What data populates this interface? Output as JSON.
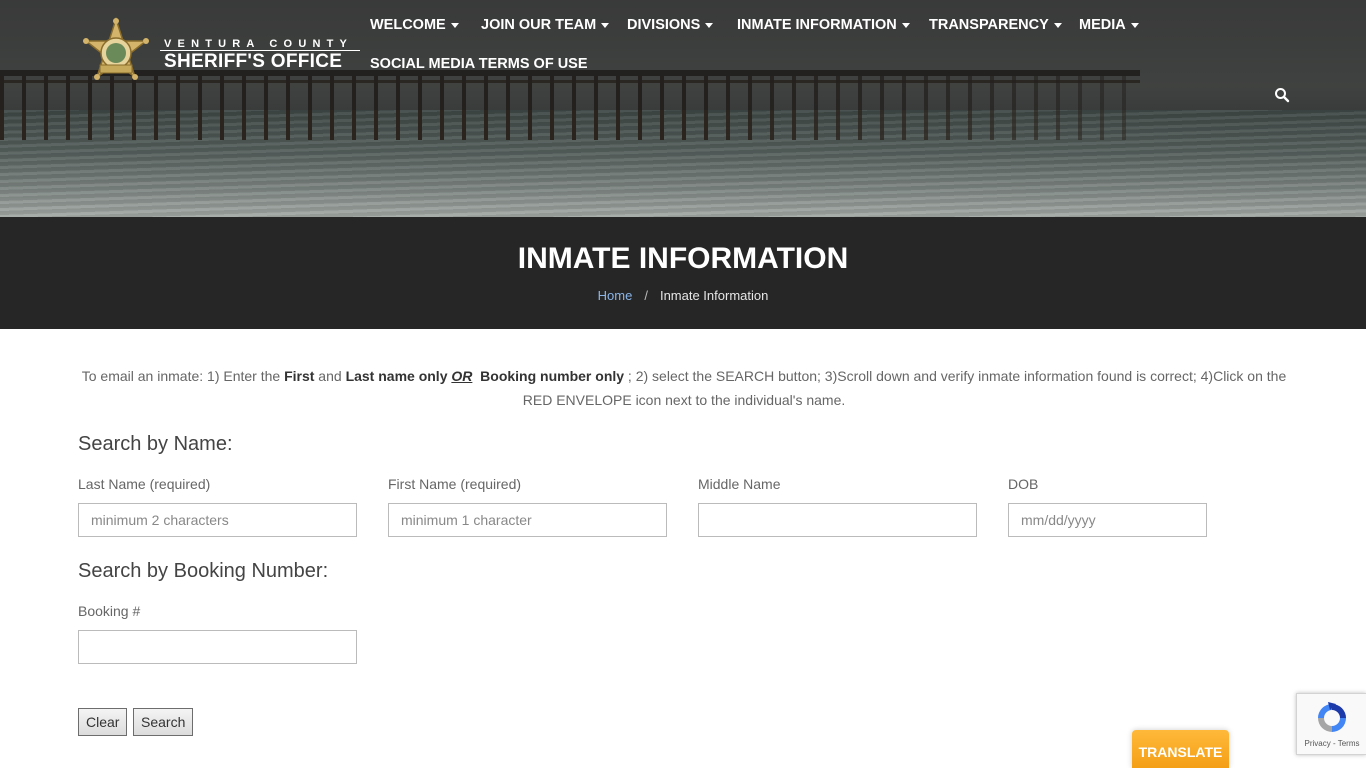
{
  "header": {
    "logo": {
      "county": "VENTURA COUNTY",
      "office": "SHERIFF'S OFFICE",
      "badge_icon": "sheriff-star-badge-icon"
    },
    "nav": [
      {
        "label": "WELCOME",
        "dropdown": true
      },
      {
        "label": "JOIN OUR TEAM",
        "dropdown": true
      },
      {
        "label": "DIVISIONS",
        "dropdown": true
      },
      {
        "label": "INMATE INFORMATION",
        "dropdown": true
      },
      {
        "label": "TRANSPARENCY",
        "dropdown": true
      },
      {
        "label": "MEDIA",
        "dropdown": true
      },
      {
        "label": "SOCIAL MEDIA TERMS OF USE",
        "dropdown": false
      }
    ],
    "search_icon": "search-icon"
  },
  "title_band": {
    "title": "INMATE INFORMATION",
    "breadcrumb": {
      "home": "Home",
      "separator": "/",
      "current": "Inmate Information"
    }
  },
  "instructions": {
    "p1": "To email an inmate: 1) Enter the ",
    "first": "First",
    "p2": " and ",
    "last_only": "Last name only",
    "or": "OR",
    "booking_only": "Booking number only",
    "p3": " ; 2) select the SEARCH button;  3)Scroll down and verify inmate information found is correct; 4)Click on the RED ENVELOPE icon next to the individual's name."
  },
  "search_by_name": {
    "heading": "Search by Name:",
    "fields": {
      "last_name": {
        "label": "Last Name (required)",
        "placeholder": "minimum 2 characters",
        "value": ""
      },
      "first_name": {
        "label": "First Name (required)",
        "placeholder": "minimum 1 character",
        "value": ""
      },
      "middle_name": {
        "label": "Middle Name",
        "placeholder": "",
        "value": ""
      },
      "dob": {
        "label": "DOB",
        "placeholder": "mm/dd/yyyy",
        "value": ""
      }
    }
  },
  "search_by_booking": {
    "heading": "Search by Booking Number:",
    "booking": {
      "label": "Booking #",
      "placeholder": "",
      "value": ""
    }
  },
  "buttons": {
    "clear": "Clear",
    "search": "Search"
  },
  "recaptcha": {
    "links": "Privacy - Terms"
  },
  "translate": {
    "label": "TRANSLATE"
  },
  "colors": {
    "title_band_bg": "#262626",
    "breadcrumb_link": "#8ab4e8",
    "translate_orange": "#f7a620"
  }
}
